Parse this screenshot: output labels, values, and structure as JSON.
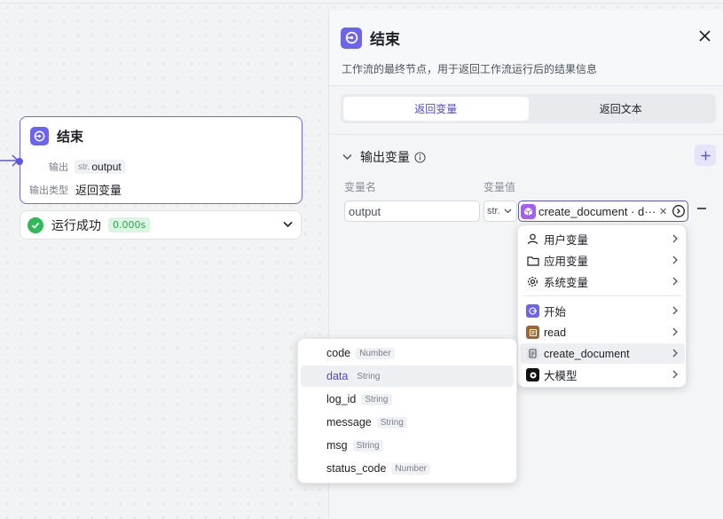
{
  "canvas": {
    "node": {
      "title": "结束",
      "output_label": "输出",
      "output_type_prefix": "str.",
      "output_value": "output",
      "output_type_label": "输出类型",
      "output_type_value": "返回变量"
    },
    "run_status": {
      "label": "运行成功",
      "time": "0.000s"
    }
  },
  "panel": {
    "title": "结束",
    "description": "工作流的最终节点，用于返回工作流运行后的结果信息",
    "tabs": [
      {
        "label": "返回变量",
        "active": true
      },
      {
        "label": "返回文本",
        "active": false
      }
    ],
    "section_title": "输出变量",
    "col_name": "变量名",
    "col_value": "变量值",
    "row": {
      "name_value": "output",
      "type": "str.",
      "value_ref": "create_document · d···"
    }
  },
  "var_menu": {
    "items": [
      {
        "label": "用户变量",
        "icon": "user-icon"
      },
      {
        "label": "应用变量",
        "icon": "folder-icon"
      },
      {
        "label": "系统变量",
        "icon": "gear-icon"
      },
      {
        "label": "开始",
        "icon": "start-node-icon"
      },
      {
        "label": "read",
        "icon": "read-node-icon"
      },
      {
        "label": "create_document",
        "icon": "create-document-node-icon"
      },
      {
        "label": "大模型",
        "icon": "llm-node-icon"
      }
    ]
  },
  "output_menu": {
    "items": [
      {
        "name": "code",
        "type": "Number"
      },
      {
        "name": "data",
        "type": "String"
      },
      {
        "name": "log_id",
        "type": "String"
      },
      {
        "name": "message",
        "type": "String"
      },
      {
        "name": "msg",
        "type": "String"
      },
      {
        "name": "status_code",
        "type": "Number"
      }
    ]
  },
  "colors": {
    "accent": "#5a55e6",
    "success": "#2fba5a",
    "panel_bg": "#f4f5f7"
  }
}
